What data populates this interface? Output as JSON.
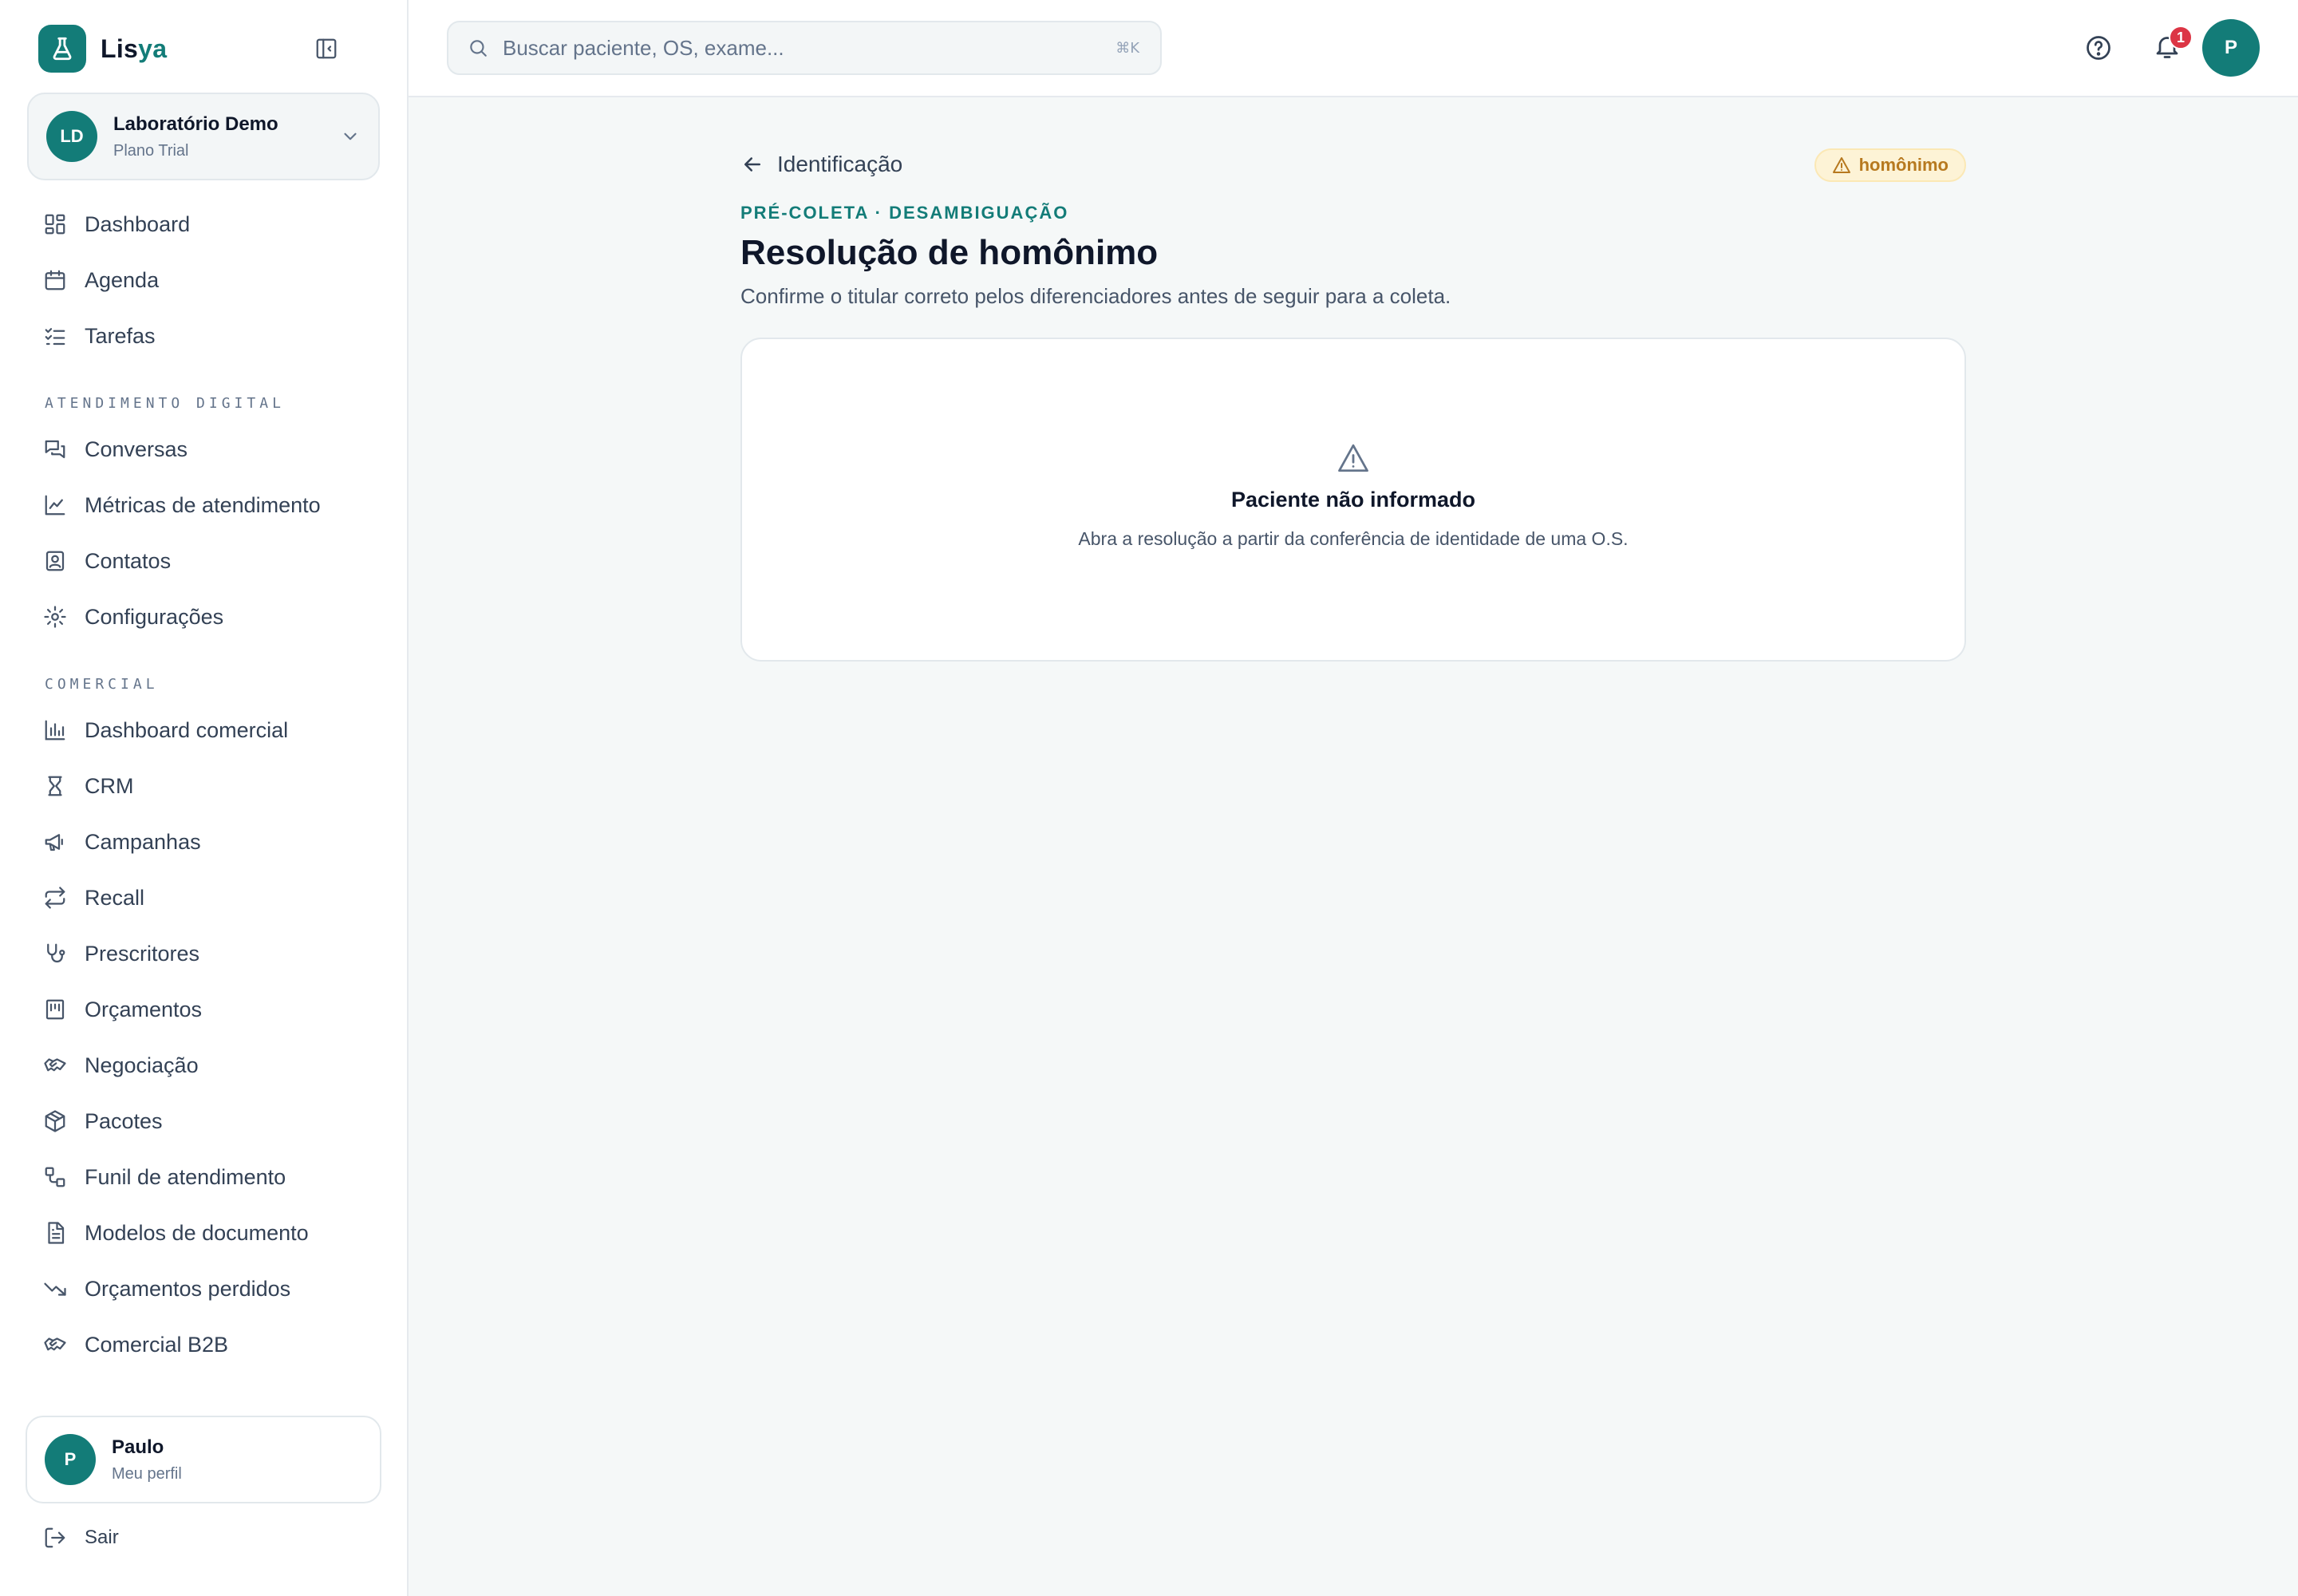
{
  "brand": {
    "name_main": "Lis",
    "name_accent": "ya"
  },
  "org": {
    "initials": "LD",
    "name": "Laboratório Demo",
    "plan": "Plano Trial"
  },
  "nav_top": [
    {
      "label": "Dashboard",
      "icon": "dashboard-icon"
    },
    {
      "label": "Agenda",
      "icon": "calendar-icon"
    },
    {
      "label": "Tarefas",
      "icon": "tasks-icon"
    }
  ],
  "sections": {
    "digital": "ATENDIMENTO DIGITAL",
    "comercial": "COMERCIAL"
  },
  "nav_digital": [
    {
      "label": "Conversas",
      "icon": "chat-icon"
    },
    {
      "label": "Métricas de atendimento",
      "icon": "line-chart-icon"
    },
    {
      "label": "Contatos",
      "icon": "contact-icon"
    },
    {
      "label": "Configurações",
      "icon": "gear-icon"
    }
  ],
  "nav_comercial": [
    {
      "label": "Dashboard comercial",
      "icon": "bar-chart-icon"
    },
    {
      "label": "CRM",
      "icon": "crm-icon"
    },
    {
      "label": "Campanhas",
      "icon": "megaphone-icon"
    },
    {
      "label": "Recall",
      "icon": "repeat-icon"
    },
    {
      "label": "Prescritores",
      "icon": "stethoscope-icon"
    },
    {
      "label": "Orçamentos",
      "icon": "receipt-icon"
    },
    {
      "label": "Negociação",
      "icon": "handshake-icon"
    },
    {
      "label": "Pacotes",
      "icon": "package-icon"
    },
    {
      "label": "Funil de atendimento",
      "icon": "workflow-icon"
    },
    {
      "label": "Modelos de documento",
      "icon": "document-icon"
    },
    {
      "label": "Orçamentos perdidos",
      "icon": "trending-down-icon"
    },
    {
      "label": "Comercial B2B",
      "icon": "handshake-icon"
    }
  ],
  "profile": {
    "initial": "P",
    "name": "Paulo",
    "sub": "Meu perfil"
  },
  "logout_label": "Sair",
  "search": {
    "placeholder": "Buscar paciente, OS, exame...",
    "shortcut": "⌘K"
  },
  "notifications": {
    "count": "1"
  },
  "user_initial": "P",
  "page": {
    "back_label": "Identificação",
    "badge": "homônimo",
    "eyebrow": "PRÉ-COLETA · DESAMBIGUAÇÃO",
    "title": "Resolução de homônimo",
    "subtitle": "Confirme o titular correto pelos diferenciadores antes de seguir para a coleta."
  },
  "empty_state": {
    "title": "Paciente não informado",
    "text": "Abra a resolução a partir da conferência de identidade de uma O.S."
  },
  "colors": {
    "brand": "#137c78",
    "badge_bg": "#fdf3d6",
    "badge_text": "#b7791f",
    "notification": "#dc3545"
  }
}
